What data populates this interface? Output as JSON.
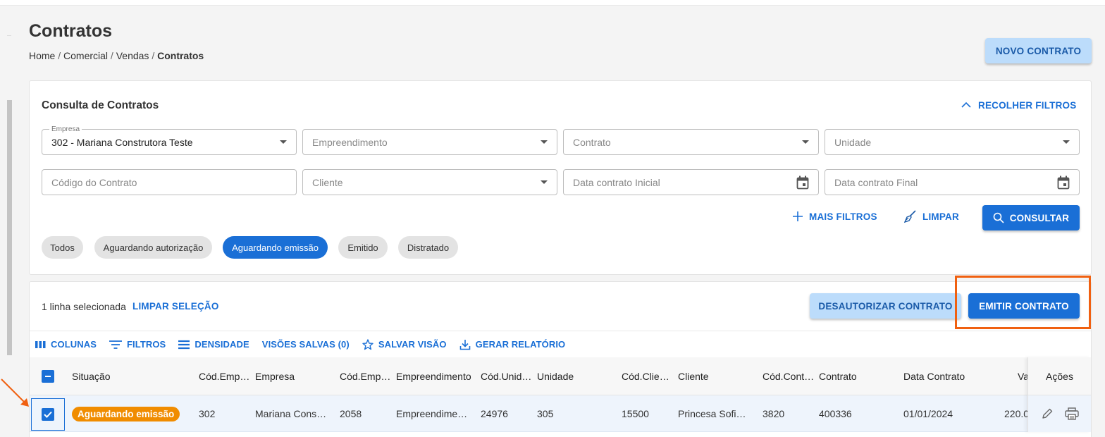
{
  "page": {
    "title": "Contratos",
    "breadcrumb": [
      "Home",
      "Comercial",
      "Vendas",
      "Contratos"
    ],
    "breadcrumb_sep": " / "
  },
  "header": {
    "novo_contrato": "NOVO CONTRATO"
  },
  "filters": {
    "title": "Consulta de Contratos",
    "recolher": "RECOLHER FILTROS",
    "empresa": {
      "label": "Empresa",
      "value": "302 - Mariana Construtora Teste"
    },
    "empreendimento": {
      "placeholder": "Empreendimento"
    },
    "contrato": {
      "placeholder": "Contrato"
    },
    "unidade": {
      "placeholder": "Unidade"
    },
    "codigo_contrato": {
      "placeholder": "Código do Contrato"
    },
    "cliente": {
      "placeholder": "Cliente"
    },
    "data_inicial": {
      "placeholder": "Data contrato Inicial"
    },
    "data_final": {
      "placeholder": "Data contrato Final"
    },
    "mais_filtros": "MAIS FILTROS",
    "limpar": "LIMPAR",
    "consultar": "CONSULTAR",
    "status_chips": [
      "Todos",
      "Aguardando autorização",
      "Aguardando emissão",
      "Emitido",
      "Distratado"
    ],
    "active_chip": "Aguardando emissão"
  },
  "selection": {
    "info": "1 linha selecionada",
    "limpar_selecao": "LIMPAR SELEÇÃO",
    "desautorizar": "DESAUTORIZAR CONTRATO",
    "emitir": "EMITIR CONTRATO"
  },
  "grid_toolbar": {
    "colunas": "COLUNAS",
    "filtros": "FILTROS",
    "densidade": "DENSIDADE",
    "visoes_salvas": "VISÕES SALVAS (0)",
    "salvar_visao": "SALVAR VISÃO",
    "gerar_relatorio": "GERAR RELATÓRIO"
  },
  "table": {
    "columns": [
      "Situação",
      "Cód.Emp…",
      "Empresa",
      "Cód.Emp…",
      "Empreendimento",
      "Cód.Unid…",
      "Unidade",
      "Cód.Clie…",
      "Cliente",
      "Cód.Cont…",
      "Contrato",
      "Data Contrato",
      "Va",
      "Ações"
    ],
    "rows": [
      {
        "situacao": "Aguardando emissão",
        "cod_emp": "302",
        "empresa": "Mariana Cons…",
        "cod_empreend": "2058",
        "empreendimento": "Empreendime…",
        "cod_unid": "24976",
        "unidade": "305",
        "cod_cliente": "15500",
        "cliente": "Princesa Sofi…",
        "cod_contrato": "3820",
        "contrato": "400336",
        "data_contrato": "01/01/2024",
        "valor": "220.0"
      }
    ]
  },
  "colors": {
    "primary": "#1a6fd6",
    "light_button": "#bcdcfb",
    "status_orange": "#f08c00",
    "highlight": "#f06010"
  }
}
